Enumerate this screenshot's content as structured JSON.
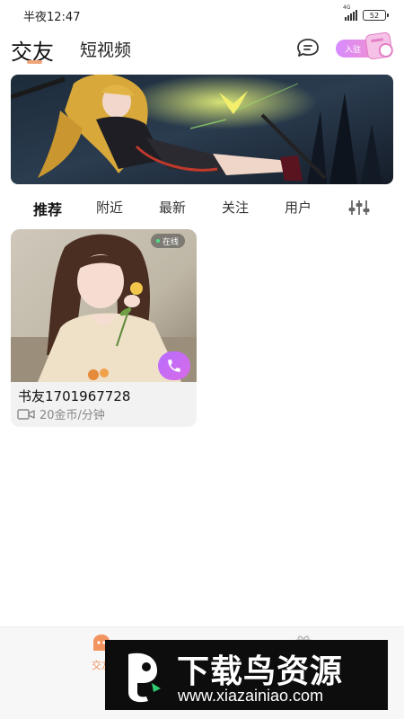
{
  "status_bar": {
    "time": "半夜12:47",
    "network": "4G",
    "battery": "52"
  },
  "header": {
    "tabs": [
      {
        "label": "交友",
        "active": true
      },
      {
        "label": "短视频",
        "active": false
      }
    ],
    "join_label": "入驻",
    "icons": [
      "message-icon",
      "join-card-icon"
    ]
  },
  "banner": {
    "alt": "anime-girl-banner"
  },
  "filters": {
    "tabs": [
      {
        "label": "推荐",
        "active": true
      },
      {
        "label": "附近",
        "active": false
      },
      {
        "label": "最新",
        "active": false
      },
      {
        "label": "关注",
        "active": false
      },
      {
        "label": "用户",
        "active": false
      }
    ],
    "filter_icon": "filter-sliders-icon"
  },
  "users": [
    {
      "status": "在线",
      "name": "书友1701967728",
      "price": "20金币/分钟"
    }
  ],
  "bottom_nav": {
    "items": [
      {
        "label": "交友",
        "icon": "home-icon",
        "active": true
      },
      {
        "label": "",
        "icon": "gift-icon",
        "active": false
      }
    ]
  },
  "watermark": {
    "title": "下载鸟资源",
    "url": "www.xiazainiao.com"
  },
  "colors": {
    "accent": "#f0a578",
    "call_gradient_start": "#b76cff",
    "call_gradient_end": "#d86be8",
    "online_dot": "#4ce08a"
  }
}
